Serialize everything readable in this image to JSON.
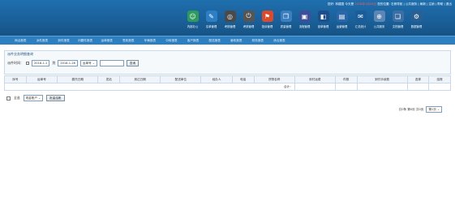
{
  "header": {
    "userbar_left": "您好: 林建国  今天是",
    "userbar_date": "2018年1月26日",
    "userbar_right": "您的位置: 右侧导航 | 公共服务 | 刷新 | 注销 | 帮助 | 退出"
  },
  "toolbar": [
    {
      "label": "内部办公",
      "icon": "office-icon",
      "color": "#2e9b5c",
      "glyph": "☺"
    },
    {
      "label": "名单管理",
      "icon": "list-icon",
      "color": "#2c7fc4",
      "glyph": "✎"
    },
    {
      "label": "考核管理",
      "icon": "target-icon",
      "color": "#4a4a4a",
      "glyph": "◎"
    },
    {
      "label": "考核管理",
      "icon": "power-icon",
      "color": "#555555",
      "glyph": "⏻"
    },
    {
      "label": "投诉管理",
      "icon": "complaint-icon",
      "color": "#d94b2b",
      "glyph": "⚑"
    },
    {
      "label": "质量管理",
      "icon": "document-icon",
      "color": "#3b7fbf",
      "glyph": "❐"
    },
    {
      "label": "流程管理",
      "icon": "monitor-icon",
      "color": "#3d4e9b",
      "glyph": "▣"
    },
    {
      "label": "回单管理",
      "icon": "receipt-icon",
      "color": "#1d4f8c",
      "glyph": "◧"
    },
    {
      "label": "运营管理",
      "icon": "chart-icon",
      "color": "#2a66a8",
      "glyph": "▤"
    },
    {
      "label": "汇总统计",
      "icon": "ticket-icon",
      "color": "#1b5c9a",
      "glyph": "✉"
    },
    {
      "label": "公共服务",
      "icon": "globe-icon",
      "color": "#5b86b5",
      "glyph": "⊕"
    },
    {
      "label": "文档管理",
      "icon": "folder-icon",
      "color": "#3c6fa3",
      "glyph": "❏"
    },
    {
      "label": "数据管理",
      "icon": "settings-icon",
      "color": "#2a5f93",
      "glyph": "⚙"
    }
  ],
  "nav": [
    "网点报表",
    "派件报表",
    "到件报表",
    "问题件报表",
    "运单报表",
    "签收报表",
    "车辆报表",
    "中转报表",
    "客户报表",
    "配送报表",
    "营收报表",
    "财务报表",
    "综合报表"
  ],
  "panel": {
    "title": "派件业务明细查询",
    "time_label": "派件时间：",
    "date_from": "2018-1-1",
    "to_label": "到",
    "date_to": "2018-1-26",
    "type_select": "运单号",
    "keyword_value": "",
    "query_label": "查询"
  },
  "table": {
    "headers": [
      "序号",
      "运单号",
      "委托日期",
      "发站",
      "到达日期",
      "配送单位",
      "经办人",
      "电话",
      "货物名称",
      "到付运费",
      "件数",
      "到付手续费",
      "选择",
      "结账"
    ],
    "total_label": "合计："
  },
  "footer": {
    "select_all": "全选",
    "account_select": "现金账户",
    "settle_label": "批量结账"
  },
  "pager": {
    "info": "共0条  第0页  共0页",
    "page_select": "第1页"
  }
}
